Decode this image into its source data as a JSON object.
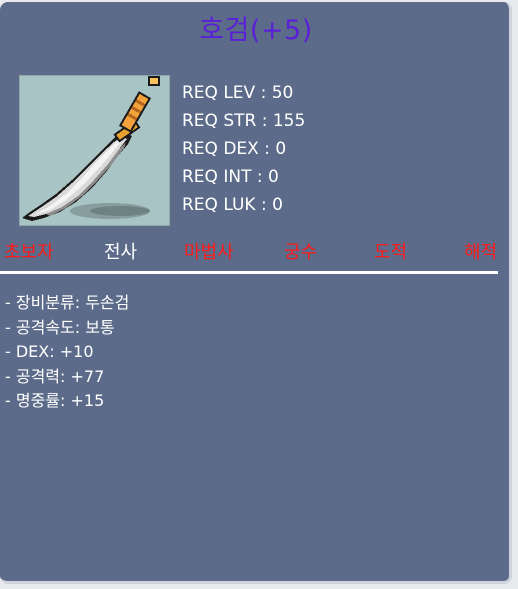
{
  "item": {
    "name": "호검(+5)",
    "image_icon": "two-handed-sword-icon",
    "title_color": "#5a1fd6"
  },
  "requirements": [
    "REQ LEV : 50",
    "REQ STR : 155",
    "REQ DEX : 0",
    "REQ INT : 0",
    "REQ LUK : 0"
  ],
  "jobs": [
    {
      "label": "초보자",
      "allowed": false
    },
    {
      "label": "전사",
      "allowed": true
    },
    {
      "label": "마법사",
      "allowed": false
    },
    {
      "label": "궁수",
      "allowed": false
    },
    {
      "label": "도적",
      "allowed": false
    },
    {
      "label": "해적",
      "allowed": false
    }
  ],
  "job_colors": {
    "allowed": "#ffffff",
    "not_allowed": "#ff1a1a"
  },
  "stats": [
    "- 장비분류: 두손검",
    "- 공격속도: 보통",
    "- DEX: +10",
    "- 공격력: +77",
    "- 명중률: +15"
  ],
  "card_color": "#5c6b89"
}
